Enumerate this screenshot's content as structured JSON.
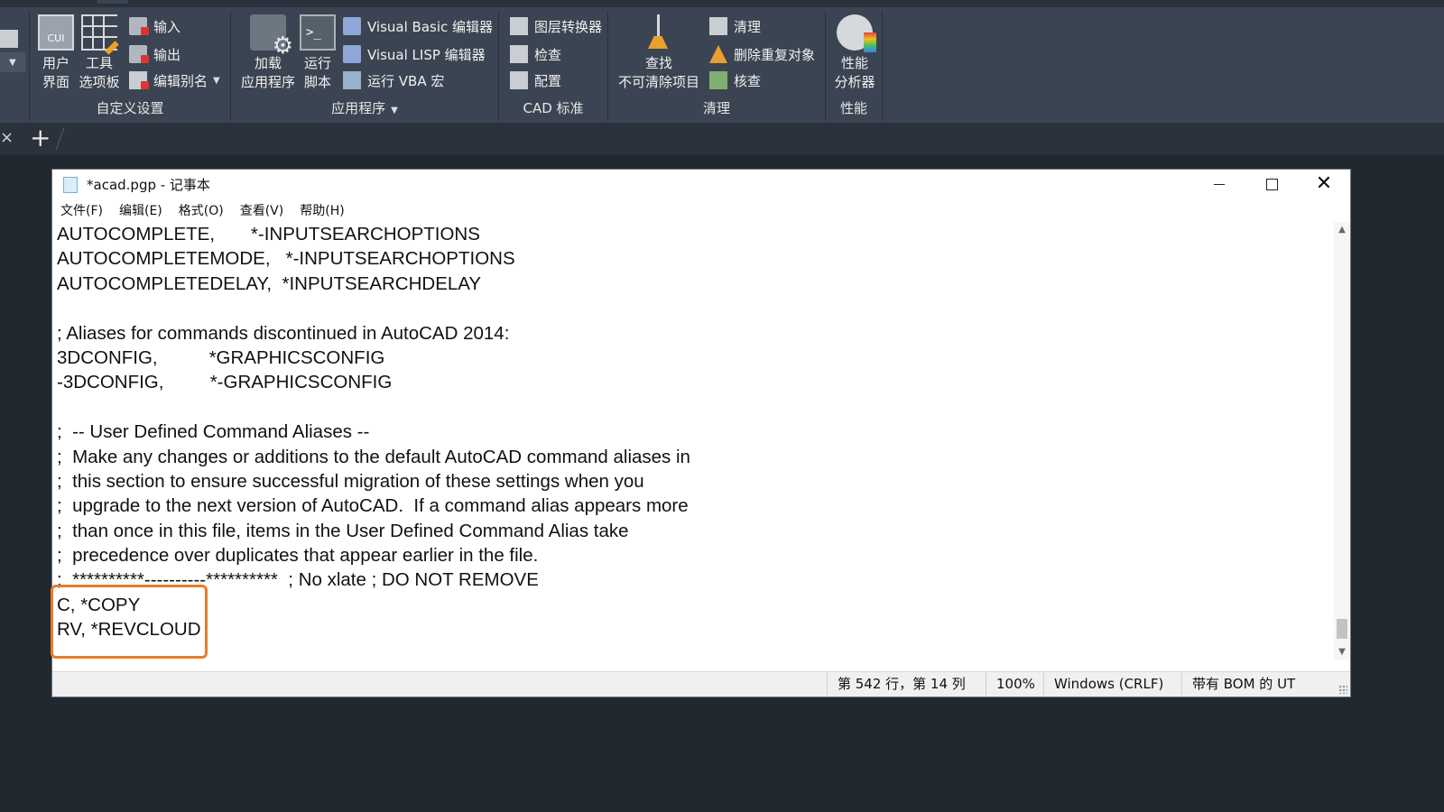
{
  "ribbon": {
    "customize": {
      "label": "自定义设置",
      "user_interface": {
        "line1": "用户",
        "line2": "界面"
      },
      "tool_palettes": {
        "line1": "工具",
        "line2": "选项板"
      },
      "import": "输入",
      "export": "输出",
      "edit_aliases": "编辑别名"
    },
    "applications": {
      "label": "应用程序",
      "load_app": {
        "line1": "加载",
        "line2": "应用程序"
      },
      "run_script": {
        "line1": "运行",
        "line2": "脚本"
      },
      "vb_editor": "Visual Basic 编辑器",
      "vlisp_editor": "Visual LISP 编辑器",
      "run_vba": "运行 VBA 宏"
    },
    "cad_standards": {
      "label": "CAD 标准",
      "layer_translator": "图层转换器",
      "check": "检查",
      "configure": "配置"
    },
    "purge": {
      "label": "清理",
      "find_nonpurgeable": {
        "line1": "查找",
        "line2": "不可清除项目"
      },
      "purge": "清理",
      "overkill": "删除重复对象",
      "audit": "核查"
    },
    "performance": {
      "label": "性能",
      "analyzer": {
        "line1": "性能",
        "line2": "分析器"
      }
    }
  },
  "docbar": {
    "close_glyph": "×",
    "add_glyph": "+"
  },
  "notepad": {
    "title": "*acad.pgp - 记事本",
    "menu": [
      "文件(F)",
      "编辑(E)",
      "格式(O)",
      "查看(V)",
      "帮助(H)"
    ],
    "lines": [
      "AUTOCOMPLETE,       *-INPUTSEARCHOPTIONS",
      "AUTOCOMPLETEMODE,   *-INPUTSEARCHOPTIONS",
      "AUTOCOMPLETEDELAY,  *INPUTSEARCHDELAY",
      "",
      "; Aliases for commands discontinued in AutoCAD 2014:",
      "3DCONFIG,          *GRAPHICSCONFIG",
      "-3DCONFIG,         *-GRAPHICSCONFIG",
      "",
      ";  -- User Defined Command Aliases --",
      ";  Make any changes or additions to the default AutoCAD command aliases in",
      ";  this section to ensure successful migration of these settings when you",
      ";  upgrade to the next version of AutoCAD.  If a command alias appears more",
      ";  than once in this file, items in the User Defined Command Alias take",
      ";  precedence over duplicates that appear earlier in the file.",
      ";  **********----------**********  ; No xlate ; DO NOT REMOVE",
      "C, *COPY",
      "RV, *REVCLOUD"
    ],
    "status": {
      "position": "第 542 行，第 14 列",
      "zoom": "100%",
      "line_ending": "Windows (CRLF)",
      "encoding": "带有 BOM 的 UT"
    }
  },
  "colors": {
    "ribbon_bg": "#3b4452",
    "workspace_bg": "#212830",
    "highlight": "#e87c2a"
  }
}
